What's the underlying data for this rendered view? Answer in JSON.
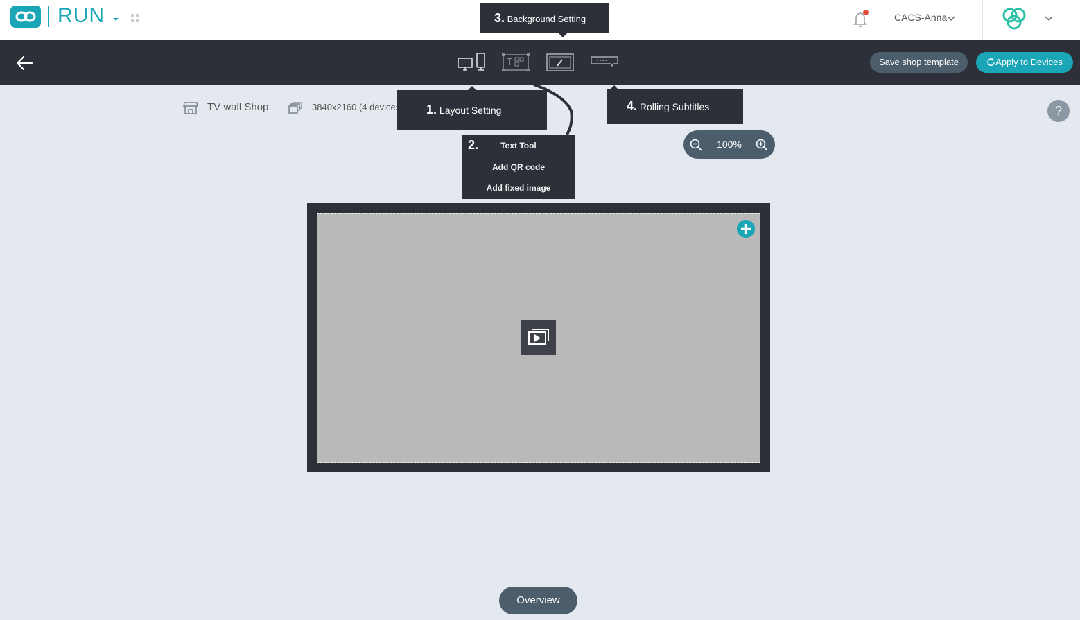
{
  "header": {
    "app_name": "RUN",
    "user_name": "CACS-Anna",
    "accent_color": "#1aa6b7",
    "notification_dot_color": "#e84c3d",
    "icons": [
      "logo-icon",
      "caret-down-icon",
      "app-grid-icon",
      "bell-icon",
      "chevron-down-icon",
      "brand-circles-icon"
    ]
  },
  "toolbar": {
    "back_icon": "arrow-left-icon",
    "tools": [
      "layout-setting-icon",
      "text-tool-icon",
      "background-setting-icon",
      "rolling-subtitles-icon"
    ],
    "save_label": "Save shop template",
    "apply_label": "Apply to Devices"
  },
  "info": {
    "shop_name": "TV wall Shop",
    "resolution": "3840x2160 (4 devices)",
    "help_label": "?"
  },
  "zoom": {
    "value": "100%"
  },
  "callouts": {
    "background": {
      "num": "3.",
      "label": "Background Setting"
    },
    "layout": {
      "num": "1.",
      "label": "Layout Setting"
    },
    "rolling": {
      "num": "4.",
      "label": "Rolling Subtitles"
    },
    "text": {
      "num": "2.",
      "items": [
        "Text Tool",
        "Add QR code",
        "Add fixed image"
      ]
    }
  },
  "canvas": {
    "add_icon": "plus-icon",
    "media_icon": "media-play-icon"
  },
  "footer": {
    "overview_label": "Overview"
  }
}
